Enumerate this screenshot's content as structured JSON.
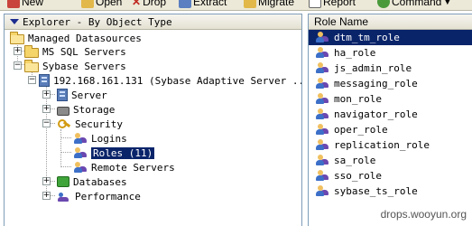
{
  "toolbar": {
    "items": [
      {
        "label": "New",
        "icon": "new-icon"
      },
      {
        "label": "Open",
        "icon": "open-icon"
      },
      {
        "label": "Drop",
        "icon": "drop-icon"
      },
      {
        "label": "Extract",
        "icon": "extract-icon"
      },
      {
        "label": "Migrate",
        "icon": "migrate-icon"
      },
      {
        "label": "Report",
        "icon": "report-icon"
      },
      {
        "label": "Command",
        "icon": "command-icon"
      }
    ]
  },
  "explorer": {
    "title": "Explorer - By Object Type",
    "tree": {
      "managed_datasources": "Managed Datasources",
      "ms_sql_servers": "MS SQL Servers",
      "sybase_servers": "Sybase Servers",
      "server_node": "192.168.161.131 (Sybase Adaptive Server ...",
      "server": "Server",
      "storage": "Storage",
      "security": "Security",
      "logins": "Logins",
      "roles": "Roles (11)",
      "remote_servers": "Remote Servers",
      "databases": "Databases",
      "performance": "Performance"
    }
  },
  "roles": {
    "column_header": "Role Name",
    "selected_index": 0,
    "items": [
      "dtm_tm_role",
      "ha_role",
      "js_admin_role",
      "messaging_role",
      "mon_role",
      "navigator_role",
      "oper_role",
      "replication_role",
      "sa_role",
      "sso_role",
      "sybase_ts_role"
    ]
  },
  "watermark": "drops.wooyun.org",
  "colors": {
    "selection": "#0a246a",
    "header_tri": "#1d2c8f",
    "panel_border": "#7f9db9"
  }
}
